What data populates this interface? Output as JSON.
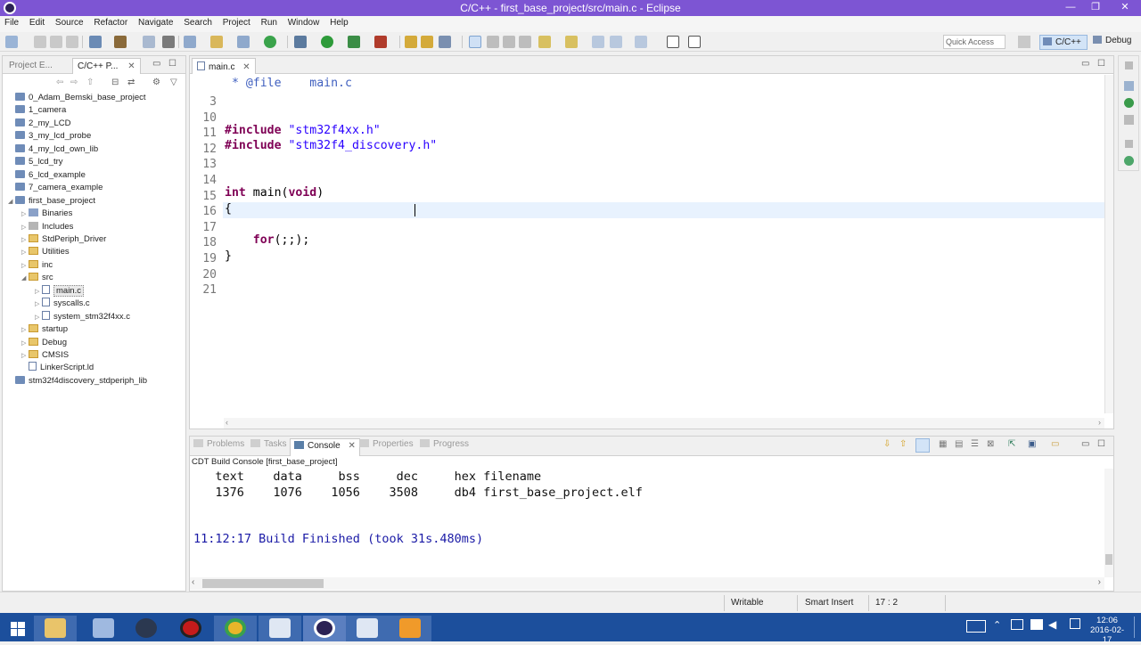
{
  "window": {
    "title": "C/C++ - first_base_project/src/main.c - Eclipse",
    "minimize": "—",
    "restore": "❐",
    "close": "✕"
  },
  "menu": [
    "File",
    "Edit",
    "Source",
    "Refactor",
    "Navigate",
    "Search",
    "Project",
    "Run",
    "Window",
    "Help"
  ],
  "toolbar": {
    "quick_access": "Quick Access",
    "perspective_cc": "C/C++",
    "perspective_debug": "Debug"
  },
  "left_panel": {
    "tabs": [
      "Project E...",
      "C/C++ P..."
    ],
    "tree": [
      {
        "label": "0_Adam_Bemski_base_project",
        "depth": 0,
        "icon": "project"
      },
      {
        "label": "1_camera",
        "depth": 0,
        "icon": "project"
      },
      {
        "label": "2_my_LCD",
        "depth": 0,
        "icon": "project"
      },
      {
        "label": "3_my_lcd_probe",
        "depth": 0,
        "icon": "project"
      },
      {
        "label": "4_my_lcd_own_lib",
        "depth": 0,
        "icon": "project"
      },
      {
        "label": "5_lcd_try",
        "depth": 0,
        "icon": "project"
      },
      {
        "label": "6_lcd_example",
        "depth": 0,
        "icon": "project"
      },
      {
        "label": "7_camera_example",
        "depth": 0,
        "icon": "project"
      },
      {
        "label": "first_base_project",
        "depth": 0,
        "icon": "project",
        "expanded": true
      },
      {
        "label": "Binaries",
        "depth": 1,
        "icon": "binary"
      },
      {
        "label": "Includes",
        "depth": 1,
        "icon": "include"
      },
      {
        "label": "StdPeriph_Driver",
        "depth": 1,
        "icon": "folder"
      },
      {
        "label": "Utilities",
        "depth": 1,
        "icon": "folder"
      },
      {
        "label": "inc",
        "depth": 1,
        "icon": "folder"
      },
      {
        "label": "src",
        "depth": 1,
        "icon": "folder",
        "expanded": true
      },
      {
        "label": "main.c",
        "depth": 2,
        "icon": "cfile",
        "selected": true
      },
      {
        "label": "syscalls.c",
        "depth": 2,
        "icon": "cfile"
      },
      {
        "label": "system_stm32f4xx.c",
        "depth": 2,
        "icon": "cfile"
      },
      {
        "label": "startup",
        "depth": 1,
        "icon": "folder"
      },
      {
        "label": "Debug",
        "depth": 1,
        "icon": "folder"
      },
      {
        "label": "CMSIS",
        "depth": 1,
        "icon": "folder"
      },
      {
        "label": "LinkerScript.ld",
        "depth": 1,
        "icon": "file"
      },
      {
        "label": "stm32f4discovery_stdperiph_lib",
        "depth": 0,
        "icon": "project"
      }
    ]
  },
  "editor": {
    "tab": "main.c",
    "lines": [
      {
        "n": "3",
        "text": " * @file    main.c"
      },
      {
        "n": "10",
        "text": ""
      },
      {
        "n": "11",
        "text": ""
      },
      {
        "n": "12",
        "text": "#include \"stm32f4xx.h\""
      },
      {
        "n": "13",
        "text": "#include \"stm32f4_discovery.h\""
      },
      {
        "n": "14",
        "text": ""
      },
      {
        "n": "15",
        "text": ""
      },
      {
        "n": "16",
        "text": "int main(void)"
      },
      {
        "n": "17",
        "text": "{"
      },
      {
        "n": "18",
        "text": ""
      },
      {
        "n": "19",
        "text": "    for(;;);"
      },
      {
        "n": "20",
        "text": "}"
      },
      {
        "n": "21",
        "text": ""
      }
    ]
  },
  "console": {
    "tabs": [
      "Problems",
      "Tasks",
      "Console",
      "Properties",
      "Progress"
    ],
    "header": "CDT Build Console [first_base_project]",
    "lines": [
      "   text    data     bss     dec     hex filename",
      "   1376    1076    1056    3508     db4 first_base_project.elf",
      "",
      "",
      "11:12:17 Build Finished (took 31s.480ms)"
    ]
  },
  "status": {
    "writable": "Writable",
    "insert_mode": "Smart Insert",
    "position": "17 : 2"
  },
  "taskbar": {
    "time": "12:06",
    "date": "2016-02-17"
  }
}
